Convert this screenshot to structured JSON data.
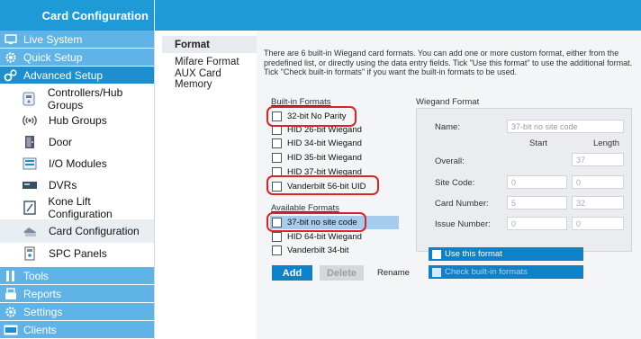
{
  "header": {
    "title": "Card Configuration"
  },
  "sidebar": {
    "main": [
      {
        "label": "Live System",
        "icon": "monitor-icon"
      },
      {
        "label": "Quick Setup",
        "icon": "gear-icon"
      },
      {
        "label": "Advanced Setup",
        "icon": "gears-icon"
      }
    ],
    "sub": [
      {
        "label": "Controllers/Hub Groups",
        "icon": "controller-icon"
      },
      {
        "label": "Hub Groups",
        "icon": "wireless-hub-icon"
      },
      {
        "label": "Door",
        "icon": "door-icon"
      },
      {
        "label": "I/O Modules",
        "icon": "io-module-icon"
      },
      {
        "label": "DVRs",
        "icon": "dvr-icon"
      },
      {
        "label": "Kone Lift Configuration",
        "icon": "lift-icon"
      },
      {
        "label": "Card Configuration",
        "icon": "card-config-icon"
      },
      {
        "label": "SPC Panels",
        "icon": "spc-panel-icon"
      }
    ],
    "bottom": [
      {
        "label": "Tools",
        "icon": "tools-icon"
      },
      {
        "label": "Reports",
        "icon": "reports-icon"
      },
      {
        "label": "Settings",
        "icon": "settings-icon"
      },
      {
        "label": "Clients",
        "icon": "clients-icon"
      }
    ]
  },
  "midnav": {
    "items": [
      "Format",
      "Mifare Format",
      "AUX Card Memory"
    ]
  },
  "content": {
    "intro": "There are 6 built-in Wiegand card formats. You can add one or more custom format, either from the predefined list, or directly using the data entry fields. Tick \"Use this format\" to use the additional format. Tick \"Check built-in formats\" if you want the built-in formats to be used.",
    "builtin": {
      "title": "Built-in Formats",
      "items": [
        "32-bit No Parity",
        "HID 26-bit Wiegand",
        "HID 34-bit Wiegand",
        "HID 35-bit Wiegand",
        "HID 37-bit Wiegand",
        "Vanderbilt 56-bit UID"
      ]
    },
    "available": {
      "title": "Available Formats",
      "items": [
        "37-bit no site code",
        "HID 64-bit Wiegand",
        "Vanderbilt 34-bit"
      ]
    },
    "wiegand": {
      "title": "Wiegand Format",
      "name_label": "Name:",
      "name_value": "37-bit no site code",
      "start_label": "Start",
      "length_label": "Length",
      "overall_label": "Overall:",
      "overall_length": "37",
      "site_label": "Site Code:",
      "site_start": "0",
      "site_length": "0",
      "card_label": "Card Number:",
      "card_start": "5",
      "card_length": "32",
      "issue_label": "Issue Number:",
      "issue_start": "0",
      "issue_length": "0",
      "use_format": "Use this format",
      "check_builtin": "Check built-in formats"
    },
    "buttons": {
      "add": "Add",
      "delete": "Delete",
      "rename": "Rename"
    }
  },
  "colors": {
    "accent": "#1e9bd7",
    "nav": "#5fb3e6",
    "highlight": "#d92525"
  }
}
